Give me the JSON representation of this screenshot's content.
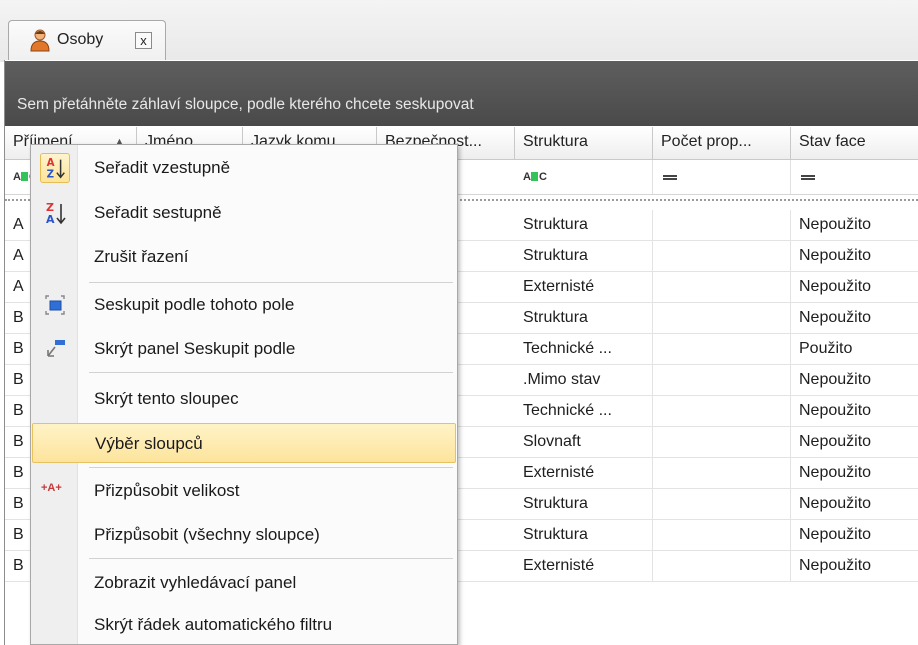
{
  "tab": {
    "label": "Osoby",
    "close_glyph": "x"
  },
  "group_panel": {
    "hint": "Sem přetáhněte záhlaví sloupce, podle kterého chcete seskupovat"
  },
  "columns": [
    "Příjmení",
    "Jméno",
    "Jazyk komu...",
    "Bezpečnost...",
    "Struktura",
    "Počet prop...",
    "Stav face"
  ],
  "first_column_sort_glyph": "▲",
  "rows": [
    {
      "c0": "A",
      "struktura": "Struktura",
      "stav": "Nepoužito"
    },
    {
      "c0": "A",
      "struktura": "Struktura",
      "stav": "Nepoužito"
    },
    {
      "c0": "A",
      "struktura": "Externisté",
      "stav": "Nepoužito"
    },
    {
      "c0": "B",
      "struktura": "Struktura",
      "stav": "Nepoužito"
    },
    {
      "c0": "B",
      "struktura": "Technické ...",
      "stav": "Použito"
    },
    {
      "c0": "B",
      "struktura": ".Mimo stav",
      "stav": "Nepoužito"
    },
    {
      "c0": "B",
      "struktura": "Technické ...",
      "stav": "Nepoužito"
    },
    {
      "c0": "B",
      "struktura": "Slovnaft",
      "stav": "Nepoužito"
    },
    {
      "c0": "B",
      "struktura": "Externisté",
      "stav": "Nepoužito"
    },
    {
      "c0": "B",
      "struktura": "Struktura",
      "stav": "Nepoužito"
    },
    {
      "c0": "B",
      "struktura": "Struktura",
      "stav": "Nepoužito"
    },
    {
      "c0": "B",
      "struktura": "Externisté",
      "stav": "Nepoužito"
    }
  ],
  "context_menu": {
    "items": [
      {
        "label": "Seřadit vzestupně",
        "icon": "sort-ascending-icon"
      },
      {
        "label": "Seřadit sestupně",
        "icon": "sort-descending-icon"
      },
      {
        "label": "Zrušit řazení",
        "icon": ""
      },
      {
        "label": "Seskupit podle tohoto pole",
        "icon": "group-by-field-icon"
      },
      {
        "label": "Skrýt panel Seskupit podle",
        "icon": "group-panel-icon"
      },
      {
        "label": "Skrýt tento sloupec",
        "icon": ""
      },
      {
        "label": "Výběr sloupců",
        "icon": ""
      },
      {
        "label": "Přizpůsobit velikost",
        "icon": "best-fit-icon"
      },
      {
        "label": "Přizpůsobit (všechny sloupce)",
        "icon": ""
      },
      {
        "label": "Zobrazit vyhledávací panel",
        "icon": ""
      },
      {
        "label": "Skrýt řádek automatického filtru",
        "icon": ""
      }
    ],
    "highlighted": "Výběr sloupců",
    "best_fit_glyph": "+A+"
  },
  "colors": {
    "group_panel": "#555555",
    "highlight": "#fde49c",
    "filter_box": "#34c25a"
  }
}
